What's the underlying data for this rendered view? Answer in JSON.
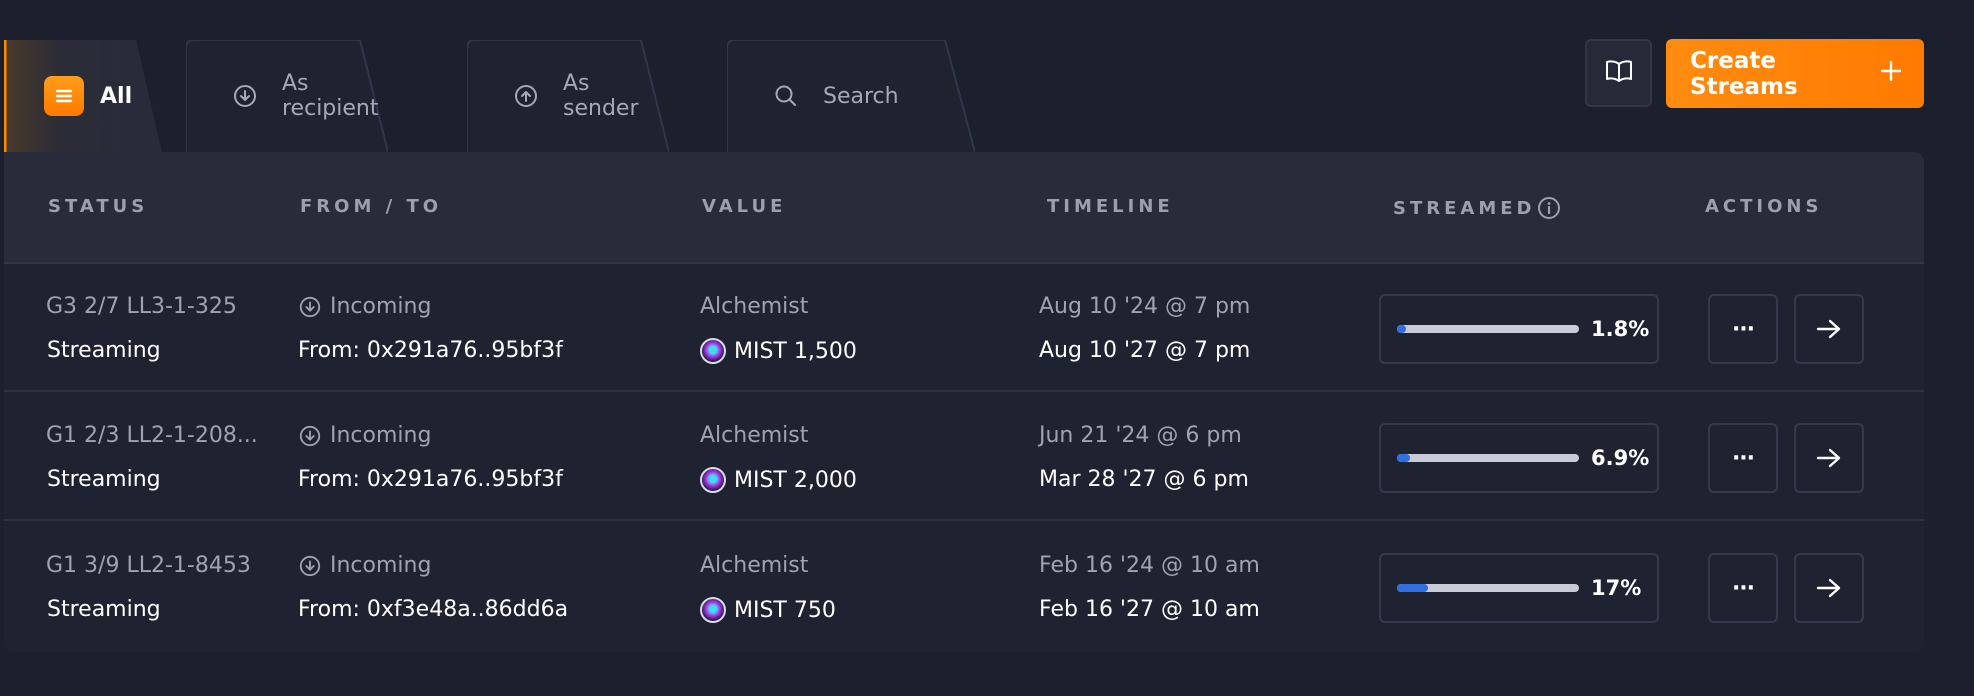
{
  "tabs": [
    {
      "label": "All",
      "icon": "list-icon",
      "active": true
    },
    {
      "label": "As recipient",
      "icon": "arrow-down-circle-icon"
    },
    {
      "label": "As sender",
      "icon": "arrow-up-circle-icon"
    },
    {
      "label": "Search",
      "icon": "search-icon"
    }
  ],
  "toolbar": {
    "guide_icon": "book-icon",
    "create_label": "Create Streams",
    "create_icon": "plus-icon"
  },
  "table": {
    "headers": {
      "status": "STATUS",
      "from_to": "FROM / TO",
      "value": "VALUE",
      "timeline": "TIMELINE",
      "streamed": "STREAMED",
      "actions": "ACTIONS"
    },
    "rows": [
      {
        "id": "G3 2/7 LL3-1-325",
        "status": "Streaming",
        "direction": "Incoming",
        "from": "From: 0x291a76..95bf3f",
        "value_label": "Alchemist",
        "amount": "MIST 1,500",
        "start": "Aug 10 '24 @ 7 pm",
        "end": "Aug 10 '27 @ 7 pm",
        "streamed_pct": "1.8%",
        "streamed_fraction": 0.018
      },
      {
        "id": "G1 2/3 LL2-1-208...",
        "status": "Streaming",
        "direction": "Incoming",
        "from": "From: 0x291a76..95bf3f",
        "value_label": "Alchemist",
        "amount": "MIST 2,000",
        "start": "Jun 21 '24 @ 6 pm",
        "end": "Mar 28 '27 @ 6 pm",
        "streamed_pct": "6.9%",
        "streamed_fraction": 0.069
      },
      {
        "id": "G1 3/9 LL2-1-8453",
        "status": "Streaming",
        "direction": "Incoming",
        "from": "From: 0xf3e48a..86dd6a",
        "value_label": "Alchemist",
        "amount": "MIST 750",
        "start": "Feb 16 '24 @ 10 am",
        "end": "Feb 16 '27 @ 10 am",
        "streamed_pct": "17%",
        "streamed_fraction": 0.17
      }
    ],
    "actions": {
      "more_label": "···",
      "more_icon": "more-dots-icon",
      "open_icon": "arrow-right-icon"
    }
  },
  "colors": {
    "accent": "#ff8400",
    "progress": "#2f6fe0",
    "background": "#1c1f2c"
  }
}
